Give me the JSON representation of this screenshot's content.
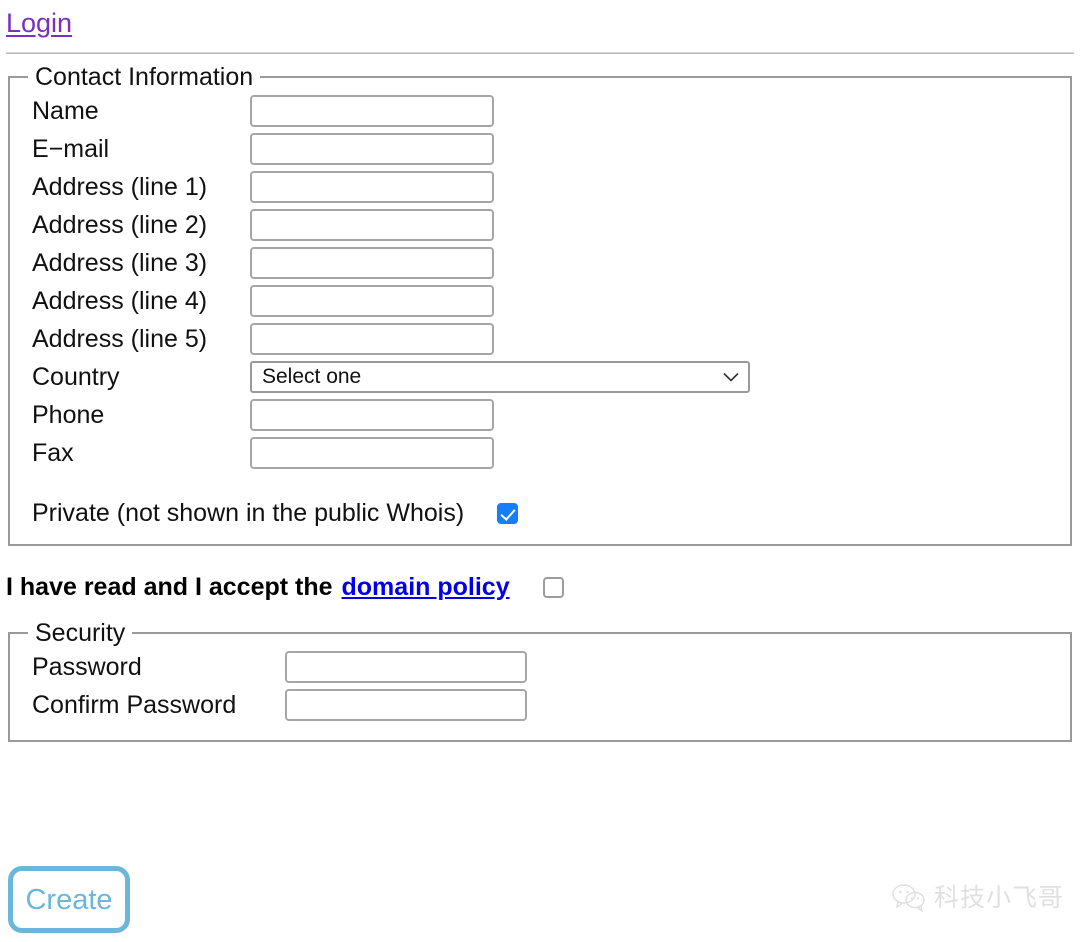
{
  "header": {
    "login_label": "Login"
  },
  "contact": {
    "legend": "Contact Information",
    "fields": [
      {
        "label": "Name",
        "value": "",
        "type": "text"
      },
      {
        "label": "E−mail",
        "value": "",
        "type": "text"
      },
      {
        "label": "Address (line 1)",
        "value": "",
        "type": "text"
      },
      {
        "label": "Address (line 2)",
        "value": "",
        "type": "text"
      },
      {
        "label": "Address (line 3)",
        "value": "",
        "type": "text"
      },
      {
        "label": "Address (line 4)",
        "value": "",
        "type": "text"
      },
      {
        "label": "Address (line 5)",
        "value": "",
        "type": "text"
      }
    ],
    "country": {
      "label": "Country",
      "selected": "Select one",
      "options": [
        "Select one"
      ],
      "icon": "chevron-down-icon"
    },
    "phone": {
      "label": "Phone",
      "value": ""
    },
    "fax": {
      "label": "Fax",
      "value": ""
    },
    "private": {
      "label": "Private (not shown in the public Whois)",
      "checked": true,
      "checkbox_color": "#147efb"
    }
  },
  "policy": {
    "text": "I have read and I accept the",
    "link_label": "domain policy",
    "link_color": "#0000ee",
    "checked": false
  },
  "security": {
    "legend": "Security",
    "password": {
      "label": "Password",
      "value": ""
    },
    "confirm_password": {
      "label": "Confirm Password",
      "value": ""
    }
  },
  "actions": {
    "create_label": "Create",
    "create_color": "#6cb6da"
  },
  "watermark": {
    "text": "科技小飞哥",
    "icon": "wechat-icon"
  }
}
